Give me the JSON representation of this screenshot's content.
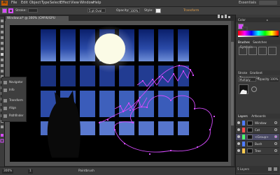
{
  "app": {
    "logo": "Ai"
  },
  "menu": {
    "items": [
      "File",
      "Edit",
      "Object",
      "Type",
      "Select",
      "Effect",
      "View",
      "Window",
      "Help"
    ],
    "workspace": "Essentials"
  },
  "control": {
    "stroke_label": "Stroke:",
    "brush_value": "5 pt Oval",
    "opacity_label": "Opacity:",
    "opacity_value": "100%",
    "style_label": "Style:",
    "transform_label": "Transform"
  },
  "document": {
    "tab_title": "Window.ai* @ 300% (CMYK/GPU Preview)",
    "close_glyph": "×"
  },
  "status": {
    "zoom": "300%",
    "page": "1",
    "tool": "Paintbrush"
  },
  "float_panel": {
    "items": [
      {
        "label": "Navigator",
        "icon": "navigator-icon"
      },
      {
        "label": "Info",
        "icon": "info-icon"
      },
      {
        "label": "Transform",
        "icon": "transform-icon"
      },
      {
        "label": "Align",
        "icon": "align-icon"
      },
      {
        "label": "Pathfinder",
        "icon": "pathfinder-icon"
      }
    ]
  },
  "right_panels": {
    "color_head": "Color",
    "swatches_tab": "Swatches",
    "brushes_tab": "Brushes",
    "symbols_tab": "Symbols",
    "stroke_tab": "Stroke",
    "gradient_tab": "Gradient",
    "transparency_tab": "Transparency",
    "blend_mode": "Multiply",
    "opacity_label": "Opacity:",
    "opacity_value": "100%",
    "layers_head": "Layers",
    "artboards_tab": "Artboards",
    "layers": [
      {
        "name": "Window",
        "color": "#4f7cff"
      },
      {
        "name": "Cat",
        "color": "#ff4f4f"
      },
      {
        "name": "<Group>",
        "color": "#4fff6f"
      },
      {
        "name": "Bush",
        "color": "#4f7cff"
      },
      {
        "name": "Tree",
        "color": "#ffcc4f"
      }
    ],
    "layers_count": "5 Layers"
  },
  "colors": {
    "selection": "#d64bff",
    "sky_top": "#0a1f6b",
    "sky_bottom": "#5f7dcf",
    "moon": "#fbfbe6",
    "accent": "#c25a00"
  }
}
